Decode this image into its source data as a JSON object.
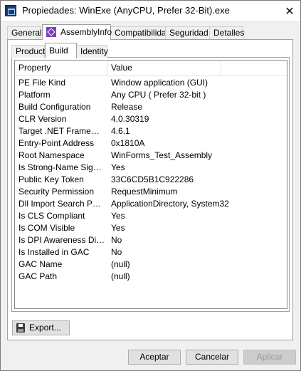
{
  "window": {
    "title": "Propiedades: WinExe (AnyCPU, Prefer 32-Bit).exe",
    "close_glyph": "✕",
    "icon": "app-icon"
  },
  "outer_tabs": [
    {
      "label": "General",
      "active": false
    },
    {
      "label": "AssemblyInfo",
      "active": true,
      "icon": "visual-studio-icon"
    },
    {
      "label": "Compatibilidad",
      "active": false
    },
    {
      "label": "Seguridad",
      "active": false
    },
    {
      "label": "Detalles",
      "active": false
    }
  ],
  "inner_tabs": [
    {
      "label": "Product",
      "active": false
    },
    {
      "label": "Build",
      "active": true
    },
    {
      "label": "Identity",
      "active": false
    }
  ],
  "table": {
    "columns": [
      "Property",
      "Value"
    ],
    "rows": [
      [
        "PE File Kind",
        "Window application (GUI)"
      ],
      [
        "Platform",
        "Any CPU ( Prefer 32-bit )"
      ],
      [
        "Build Configuration",
        "Release"
      ],
      [
        "CLR Version",
        "4.0.30319"
      ],
      [
        "Target .NET Framework",
        "4.6.1"
      ],
      [
        "Entry-Point Address",
        "0x1810A"
      ],
      [
        "Root Namespace",
        "WinForms_Test_Assembly"
      ],
      [
        "Is Strong-Name Signed",
        "Yes"
      ],
      [
        "Public Key Token",
        "33C6CD5B1C922286"
      ],
      [
        "Security Permission",
        "RequestMinimum"
      ],
      [
        "Dll Import Search Paths",
        "ApplicationDirectory, System32"
      ],
      [
        "Is CLS Compliant",
        "Yes"
      ],
      [
        "Is COM Visible",
        "Yes"
      ],
      [
        "Is DPI Awareness Disa...",
        "No"
      ],
      [
        "Is Installed in GAC",
        "No"
      ],
      [
        "GAC Name",
        "(null)"
      ],
      [
        "GAC Path",
        "(null)"
      ]
    ]
  },
  "export_button": {
    "label": "Export...",
    "icon": "save-icon"
  },
  "buttons": {
    "ok": "Aceptar",
    "cancel": "Cancelar",
    "apply": "Aplicar",
    "apply_enabled": false
  }
}
